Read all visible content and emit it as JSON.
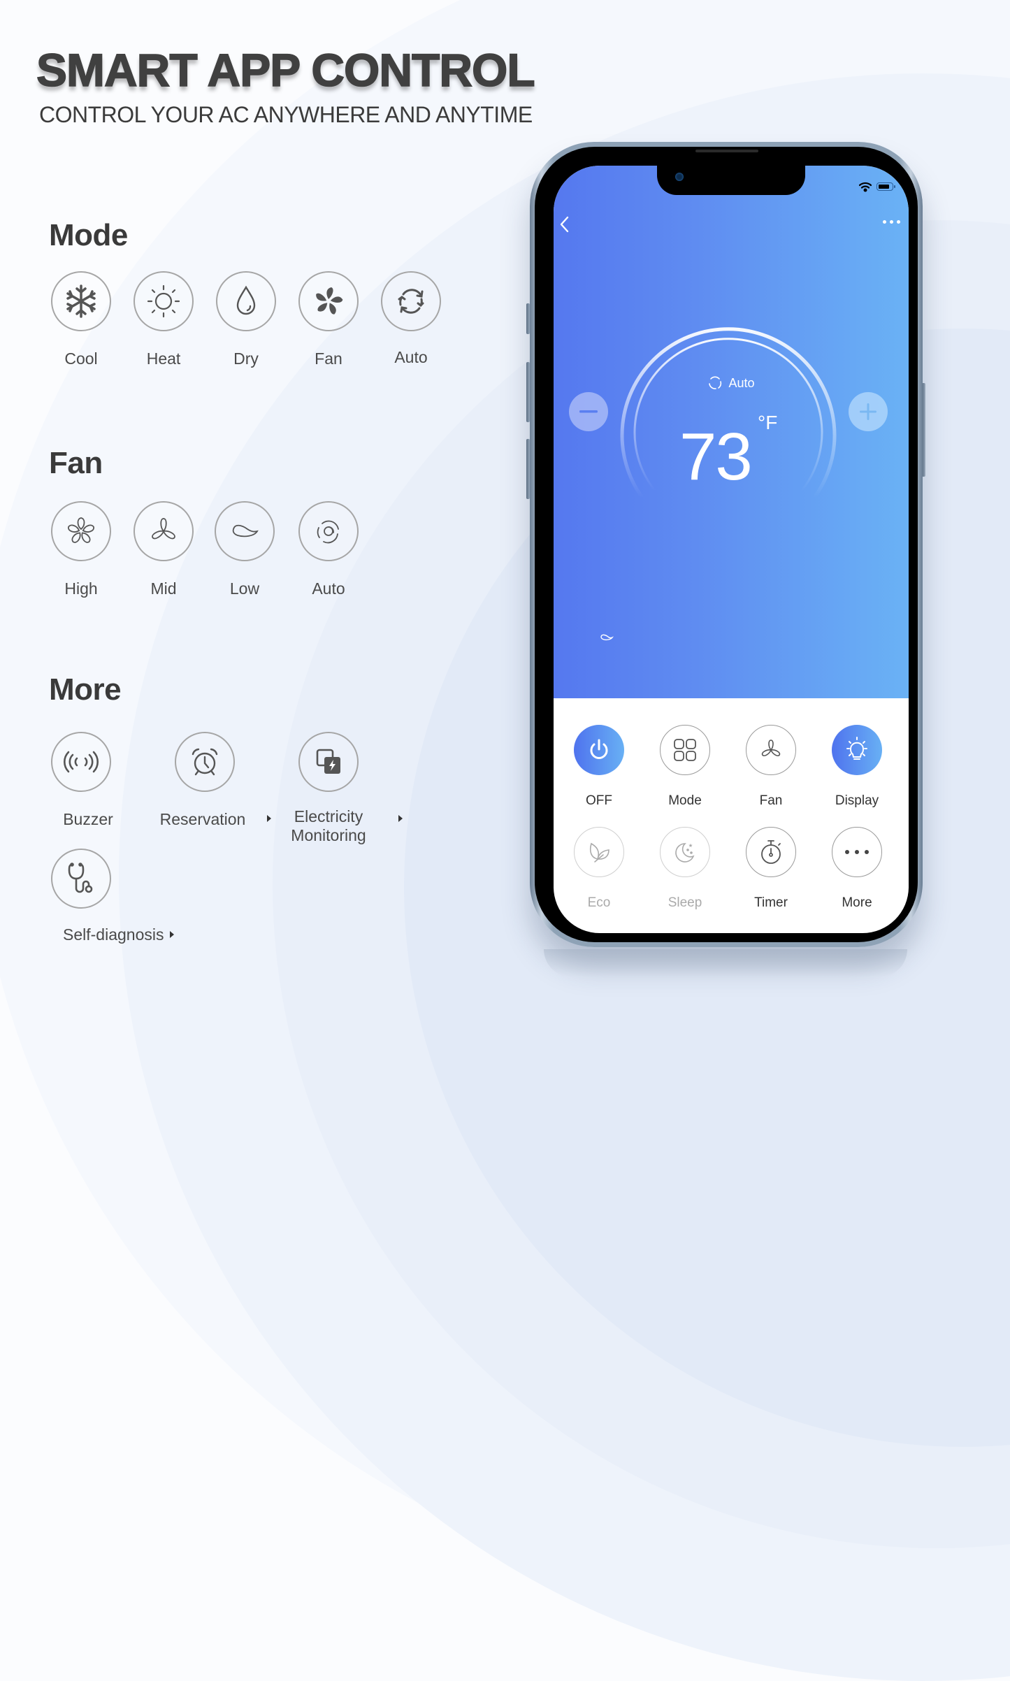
{
  "header": {
    "title": "SMART APP CONTROL",
    "subtitle": "CONTROL YOUR AC ANYWHERE AND ANYTIME"
  },
  "sections": {
    "mode": {
      "title": "Mode",
      "items": [
        {
          "label": "Cool",
          "icon": "snowflake-icon"
        },
        {
          "label": "Heat",
          "icon": "sun-icon"
        },
        {
          "label": "Dry",
          "icon": "water-drop-icon"
        },
        {
          "label": "Fan",
          "icon": "fan-icon"
        },
        {
          "label": "Auto",
          "icon": "cycle-icon"
        }
      ]
    },
    "fan": {
      "title": "Fan",
      "items": [
        {
          "label": "High",
          "icon": "fan-high-icon"
        },
        {
          "label": "Mid",
          "icon": "fan-mid-icon"
        },
        {
          "label": "Low",
          "icon": "fan-low-icon"
        },
        {
          "label": "Auto",
          "icon": "fan-auto-icon"
        }
      ]
    },
    "more": {
      "title": "More",
      "items": [
        {
          "label": "Buzzer",
          "icon": "buzzer-icon",
          "has_arrow": false
        },
        {
          "label": "Reservation",
          "icon": "alarm-clock-icon",
          "has_arrow": true
        },
        {
          "label": "Electricity",
          "label2": "Monitoring",
          "icon": "electricity-icon",
          "has_arrow": true
        },
        {
          "label": "Self-diagnosis",
          "icon": "stethoscope-icon",
          "has_arrow": true
        }
      ]
    }
  },
  "phone": {
    "status_icons": [
      "wifi-icon",
      "battery-icon"
    ],
    "current_mode": "Auto",
    "temperature": "73",
    "unit": "°F",
    "fan_speed_indicator": "fan-low-icon",
    "colors": {
      "gradient_start": "#5578ef",
      "gradient_end": "#6ab2f5",
      "active_button": "#5a8cf0"
    },
    "controls_row1": [
      {
        "label": "OFF",
        "icon": "power-icon",
        "state": "active"
      },
      {
        "label": "Mode",
        "icon": "grid-icon",
        "state": "normal"
      },
      {
        "label": "Fan",
        "icon": "fan-icon",
        "state": "normal"
      },
      {
        "label": "Display",
        "icon": "lightbulb-icon",
        "state": "active"
      }
    ],
    "controls_row2": [
      {
        "label": "Eco",
        "icon": "leaf-icon",
        "state": "disabled"
      },
      {
        "label": "Sleep",
        "icon": "moon-icon",
        "state": "disabled"
      },
      {
        "label": "Timer",
        "icon": "stopwatch-icon",
        "state": "normal"
      },
      {
        "label": "More",
        "icon": "ellipsis-icon",
        "state": "normal"
      }
    ]
  }
}
